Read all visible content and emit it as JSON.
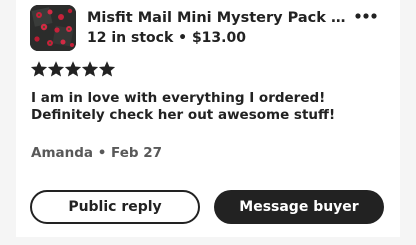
{
  "listing": {
    "title": "Misfit Mail Mini Mystery Pack | Ran...",
    "meta": "12 in stock • $13.00"
  },
  "review": {
    "rating": 5,
    "rating_max": 5,
    "text": "I am in love with everything I ordered! Definitely check her out awesome stuff!",
    "author": "Amanda • Feb 27"
  },
  "actions": {
    "public_reply_label": "Public reply",
    "message_buyer_label": "Message buyer"
  },
  "icons": {
    "more": "more-horizontal-icon",
    "star": "star-icon"
  },
  "colors": {
    "text": "#222222",
    "muted": "#595959",
    "primary_button_bg": "#222222",
    "page_bg": "#f5f5f5"
  }
}
